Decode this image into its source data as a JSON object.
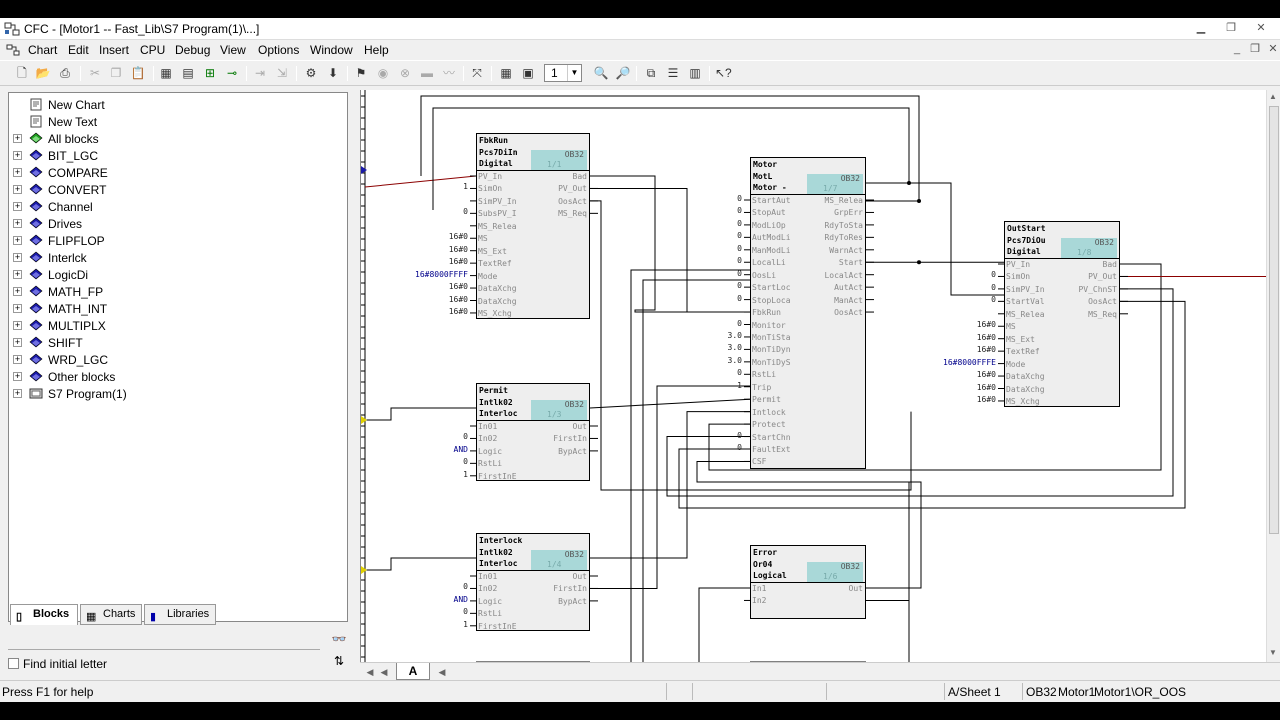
{
  "window": {
    "title": "CFC - [Motor1 -- Fast_Lib\\S7 Program(1)\\...]"
  },
  "menu": [
    "Chart",
    "Edit",
    "Insert",
    "CPU",
    "Debug",
    "View",
    "Options",
    "Window",
    "Help"
  ],
  "toolbar": {
    "zoom_value": "1"
  },
  "tree": [
    {
      "label": "New Chart",
      "icon": "chart-icon",
      "expand": false
    },
    {
      "label": "New Text",
      "icon": "text-icon",
      "expand": false
    },
    {
      "label": "All blocks",
      "icon": "all-blocks-icon",
      "expand": true
    },
    {
      "label": "BIT_LGC",
      "icon": "library-folder-icon",
      "expand": true
    },
    {
      "label": "COMPARE",
      "icon": "library-folder-icon",
      "expand": true
    },
    {
      "label": "CONVERT",
      "icon": "library-folder-icon",
      "expand": true
    },
    {
      "label": "Channel",
      "icon": "library-folder-icon",
      "expand": true
    },
    {
      "label": "Drives",
      "icon": "library-folder-icon",
      "expand": true
    },
    {
      "label": "FLIPFLOP",
      "icon": "library-folder-icon",
      "expand": true
    },
    {
      "label": "Interlck",
      "icon": "library-folder-icon",
      "expand": true
    },
    {
      "label": "LogicDi",
      "icon": "library-folder-icon",
      "expand": true
    },
    {
      "label": "MATH_FP",
      "icon": "library-folder-icon",
      "expand": true
    },
    {
      "label": "MATH_INT",
      "icon": "library-folder-icon",
      "expand": true
    },
    {
      "label": "MULTIPLX",
      "icon": "library-folder-icon",
      "expand": true
    },
    {
      "label": "SHIFT",
      "icon": "library-folder-icon",
      "expand": true
    },
    {
      "label": "WRD_LGC",
      "icon": "library-folder-icon",
      "expand": true
    },
    {
      "label": "Other blocks",
      "icon": "library-folder-icon",
      "expand": true
    },
    {
      "label": "S7 Program(1)",
      "icon": "program-icon",
      "expand": true
    }
  ],
  "left_tabs": {
    "blocks": "Blocks",
    "charts": "Charts",
    "libraries": "Libraries"
  },
  "find": {
    "label": "Find initial letter",
    "value": ""
  },
  "sheet_tab": "A",
  "status": {
    "help": "Press F1 for help",
    "sheet": "A/Sheet 1",
    "ob": "OB32",
    "chart": "Motor1",
    "object": "Motor1\\OR_OOS"
  },
  "blocks": {
    "fbkrun": {
      "name": "FbkRun",
      "type": "Pcs7DiIn",
      "desc": "Digital",
      "ob": "OB32",
      "frac": "1/1",
      "inputs": [
        "PV_In",
        "SimOn",
        "SimPV_In",
        "SubsPV_I",
        "MS_Relea",
        "MS",
        "MS_Ext",
        "TextRef",
        "Mode",
        "DataXchg",
        "DataXchg",
        "MS_Xchg"
      ],
      "outputs": [
        "Bad",
        "PV_Out",
        "OosAct",
        "MS_Req"
      ],
      "values": [
        "",
        "1",
        "",
        "0",
        "",
        "16#0",
        "16#0",
        "16#0",
        "16#8000FFFF",
        "16#0",
        "16#0",
        "16#0"
      ]
    },
    "permit": {
      "name": "Permit",
      "type": "Intlk02",
      "desc": "Interloc",
      "ob": "OB32",
      "frac": "1/3",
      "inputs": [
        "In01",
        "In02",
        "Logic",
        "RstLi",
        "FirstInE"
      ],
      "outputs": [
        "Out",
        "FirstIn",
        "BypAct"
      ],
      "values": [
        "",
        "0",
        "AND",
        "0",
        "1"
      ]
    },
    "interlock": {
      "name": "Interlock",
      "type": "Intlk02",
      "desc": "Interloc",
      "ob": "OB32",
      "frac": "1/4",
      "inputs": [
        "In01",
        "In02",
        "Logic",
        "RstLi",
        "FirstInE"
      ],
      "outputs": [
        "Out",
        "FirstIn",
        "BypAct"
      ],
      "values": [
        "",
        "0",
        "AND",
        "0",
        "1"
      ]
    },
    "motor": {
      "name": "Motor",
      "type": "MotL",
      "desc": "Motor -",
      "ob": "OB32",
      "frac": "1/7",
      "inputs": [
        "StartAut",
        "StopAut",
        "ModLiOp",
        "AutModLi",
        "ManModLi",
        "LocalLi",
        "OosLi",
        "StartLoc",
        "StopLoca",
        "FbkRun",
        "Monitor",
        "MonTiSta",
        "MonTiDyn",
        "MonTiDyS",
        "RstLi",
        "Trip",
        "Permit",
        "Intlock",
        "Protect",
        "StartChn",
        "FaultExt",
        "CSF"
      ],
      "outputs": [
        "MS_Relea",
        "GrpErr",
        "RdyToSta",
        "RdyToRes",
        "WarnAct",
        "Start",
        "LocalAct",
        "AutAct",
        "ManAct",
        "OosAct"
      ],
      "values": [
        "0",
        "0",
        "0",
        "0",
        "0",
        "0",
        "0",
        "0",
        "0",
        "",
        "0",
        "3.0",
        "3.0",
        "3.0",
        "0",
        "1",
        "",
        "",
        "",
        "0",
        "0",
        ""
      ]
    },
    "outstart": {
      "name": "OutStart",
      "type": "Pcs7DiOu",
      "desc": "Digital",
      "ob": "OB32",
      "frac": "1/8",
      "inputs": [
        "PV_In",
        "SimOn",
        "SimPV_In",
        "StartVal",
        "MS_Relea",
        "MS",
        "MS_Ext",
        "TextRef",
        "Mode",
        "DataXchg",
        "DataXchg",
        "MS_Xchg"
      ],
      "outputs": [
        "Bad",
        "PV_Out",
        "PV_ChnST",
        "OosAct",
        "MS_Req"
      ],
      "values": [
        "",
        "0",
        "0",
        "0",
        "",
        "16#0",
        "16#0",
        "16#0",
        "16#8000FFFE",
        "16#0",
        "16#0",
        "16#0"
      ]
    },
    "error": {
      "name": "Error",
      "type": "Or04",
      "desc": "Logical",
      "ob": "OB32",
      "frac": "1/6",
      "inputs": [
        "In1",
        "In2"
      ],
      "outputs": [
        "Out"
      ],
      "values": [
        "",
        ""
      ]
    }
  }
}
